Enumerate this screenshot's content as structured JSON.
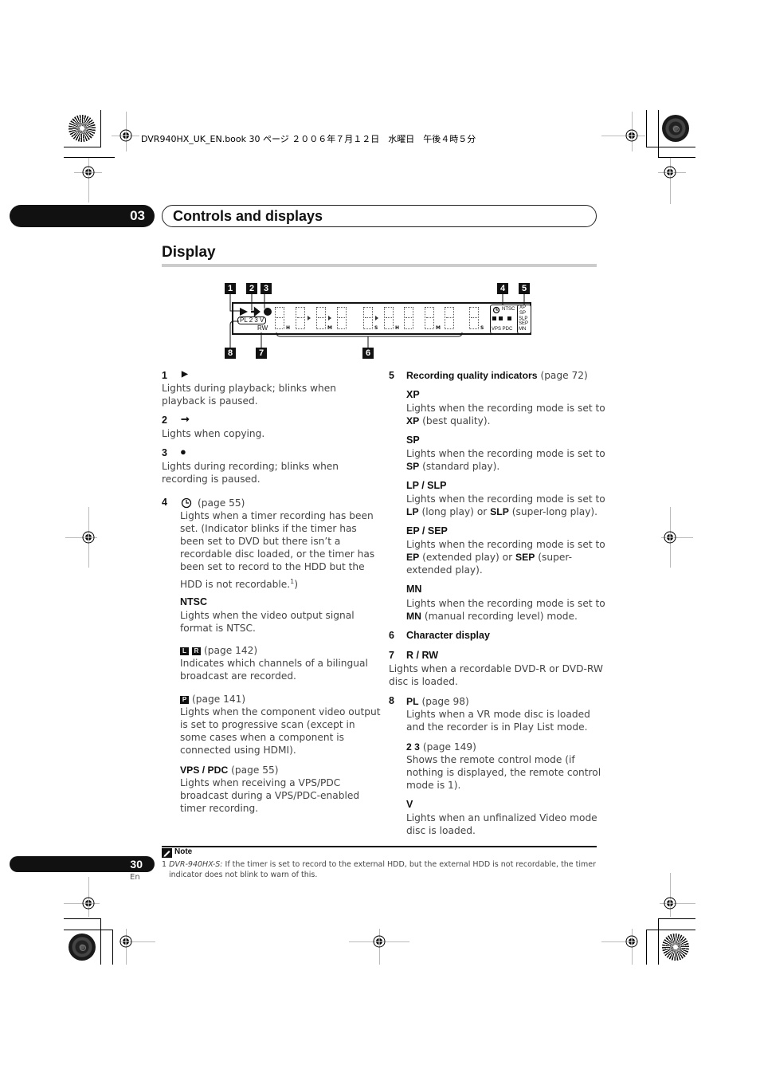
{
  "print_header": "DVR940HX_UK_EN.book  30 ページ  ２００６年７月１２日　水曜日　午後４時５分",
  "chapter": {
    "number": "03",
    "title": "Controls and displays"
  },
  "section_title": "Display",
  "diagram": {
    "callouts": [
      "1",
      "2",
      "3",
      "4",
      "5",
      "6",
      "7",
      "8"
    ],
    "left_indicators": {
      "pl_box": "PL  2 3  V",
      "rw": "RW"
    },
    "segment_subscripts": [
      "H",
      "M",
      "S",
      "H",
      "M",
      "S"
    ],
    "right_indicators": {
      "ntsc": "NTSC",
      "lr": [
        "L",
        "R"
      ],
      "p": "P",
      "vps_pdc": "VPS  PDC",
      "quality": [
        "XP",
        "SP",
        "SLP",
        "SEP",
        "MN"
      ]
    }
  },
  "left_column": [
    {
      "num": "1",
      "symbol": "▶",
      "desc": [
        "Lights during playback; blinks when",
        "playback is paused."
      ]
    },
    {
      "num": "2",
      "symbol": "➞",
      "desc": [
        "Lights when copying."
      ]
    },
    {
      "num": "3",
      "symbol": "●",
      "desc": [
        "Lights during recording; blinks when",
        "recording is paused."
      ]
    },
    {
      "num": "4",
      "symbol": "⌚",
      "page": "(page 55)",
      "desc": [
        "Lights when a timer recording has been",
        "set. (Indicator blinks if the timer has",
        "been set to DVD but there isn’t a",
        "recordable disc loaded, or the timer has",
        "been set to record to the HDD but the",
        "HDD is not recordable."
      ],
      "footnote_ref": "1",
      "desc_tail": ")"
    },
    {
      "head": "NTSC",
      "desc": [
        "Lights when the video output signal",
        "format is NTSC."
      ]
    },
    {
      "icons": [
        "L",
        "R"
      ],
      "page": "(page 142)",
      "desc": [
        "Indicates which channels of a bilingual",
        "broadcast are recorded."
      ]
    },
    {
      "icons": [
        "P"
      ],
      "page": "(page 141)",
      "desc": [
        "Lights when the component video output",
        "is set to progressive scan (except in",
        "some cases when a component is",
        "connected using HDMI)."
      ]
    },
    {
      "head": "VPS / PDC",
      "page": "(page 55)",
      "desc": [
        "Lights when receiving a VPS/PDC",
        "broadcast during a VPS/PDC-enabled",
        "timer recording."
      ]
    }
  ],
  "right_column": [
    {
      "num": "5",
      "head": "Recording quality indicators",
      "page": "(page 72)"
    },
    {
      "head": "XP",
      "desc1": "Lights when the recording mode is set to",
      "bold": "XP",
      "rest": " (best quality)."
    },
    {
      "head": "SP",
      "desc1": "Lights when the recording mode is set to",
      "bold": "SP",
      "rest": " (standard play)."
    },
    {
      "head": "LP / SLP",
      "desc1": "Lights when the recording mode is set to",
      "bold": "LP",
      "rest": " (long play) or ",
      "bold2": "SLP",
      "rest2": " (super-long play)."
    },
    {
      "head": "EP / SEP",
      "desc1": "Lights when the recording mode is set to",
      "bold": "EP",
      "rest": " (extended play) or ",
      "bold2": "SEP",
      "rest2": " (super-",
      "line3": "extended play)."
    },
    {
      "head": "MN",
      "desc1": "Lights when the recording mode is set to",
      "bold": "MN",
      "rest": " (manual recording level) mode."
    },
    {
      "num": "6",
      "head": "Character display"
    },
    {
      "num": "7",
      "head": "R / RW",
      "desc": [
        "Lights when a recordable DVD-R or DVD-RW",
        "disc is loaded."
      ]
    },
    {
      "num": "8",
      "head": "PL",
      "page": "(page 98)",
      "desc": [
        "Lights when a VR mode disc is loaded",
        "and the recorder is in Play List mode."
      ]
    },
    {
      "head": "2 3",
      "page": "(page 149)",
      "desc": [
        "Shows the remote control mode (if",
        "nothing is displayed, the remote control",
        "mode is 1)."
      ]
    },
    {
      "head": "V",
      "desc": [
        "Lights when an unfinalized Video mode",
        "disc is loaded."
      ]
    }
  ],
  "note": {
    "label": "Note",
    "num": "1",
    "model": "DVR-940HX-S:",
    "line1": " If the timer is set to record to the external HDD, but the external HDD is not recordable, the timer",
    "line2": "indicator does not blink to warn of this."
  },
  "page": {
    "number": "30",
    "lang": "En"
  }
}
